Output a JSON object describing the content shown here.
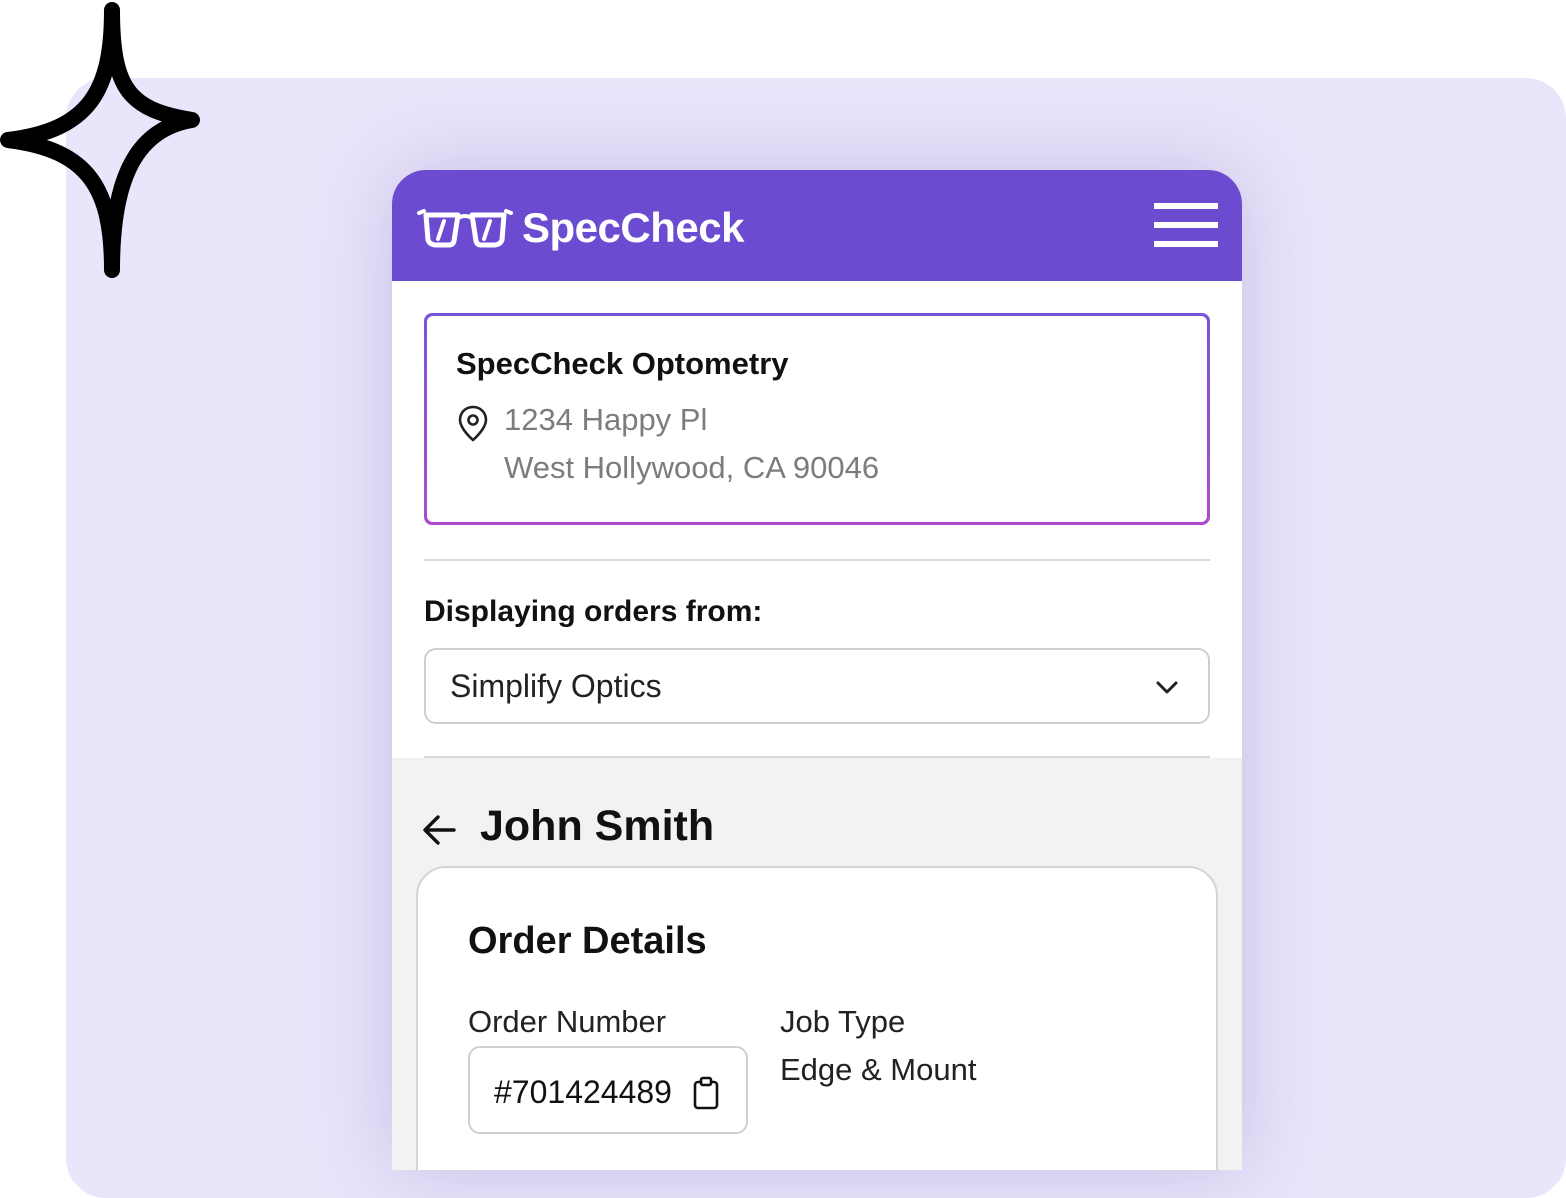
{
  "header": {
    "brand": "SpecCheck",
    "logo_icon": "glasses-icon",
    "menu_icon": "hamburger-menu-icon",
    "color": "#6b4bcf"
  },
  "location": {
    "name": "SpecCheck Optometry",
    "icon": "map-pin-icon",
    "address_line1": "1234 Happy Pl",
    "address_line2": "West Hollywood, CA 90046"
  },
  "orders_filter": {
    "label": "Displaying orders from:",
    "selected": "Simplify Optics",
    "icon": "chevron-down-icon"
  },
  "customer": {
    "back_icon": "arrow-left-icon",
    "name": "John Smith"
  },
  "order_details": {
    "title": "Order Details",
    "order_number_label": "Order Number",
    "order_number": "#701424489",
    "copy_icon": "clipboard-icon",
    "job_type_label": "Job Type",
    "job_type": "Edge & Mount"
  },
  "decor": {
    "sparkle_icon": "sparkle-icon",
    "background_color": "#e9e5fb"
  }
}
